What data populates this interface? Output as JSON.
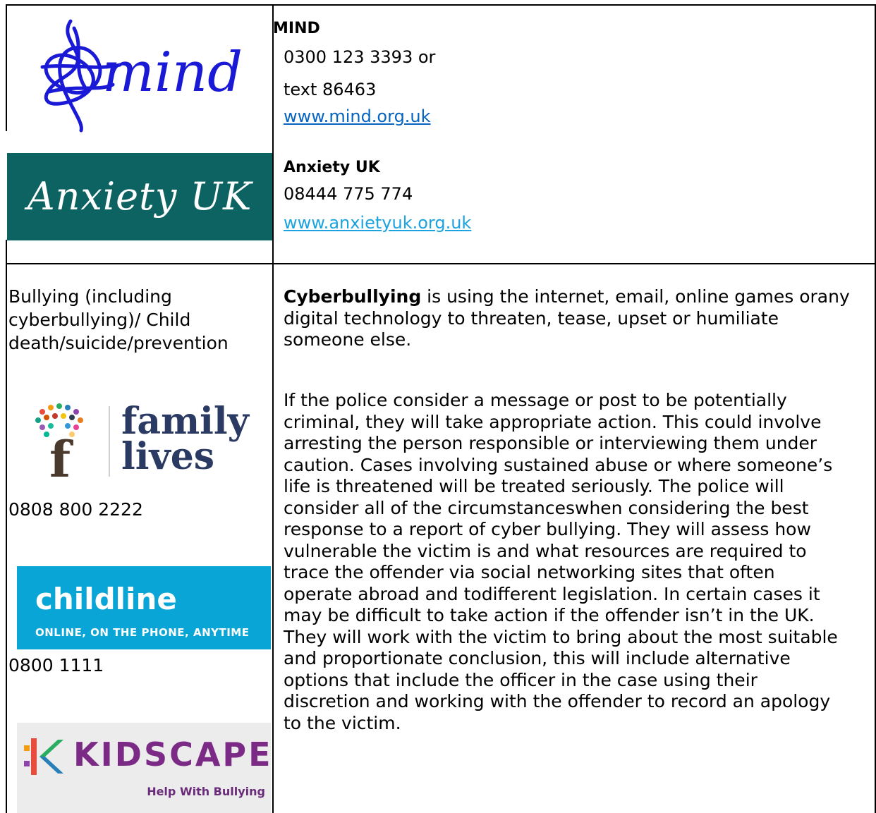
{
  "logos": {
    "mind": "mind",
    "anxiety_uk": "Anxiety UK",
    "family_lives": [
      "family",
      "lives"
    ],
    "childline": {
      "name": "childline",
      "tagline": "ONLINE, ON THE PHONE, ANYTIME"
    },
    "kidscape": {
      "name": "KIDSCAPE",
      "tagline": "Help With Bullying"
    }
  },
  "orgs": {
    "mind": {
      "name": "MIND",
      "phone": "0300 123 3393 or",
      "text": "text 86463",
      "url": "www.mind.org.uk"
    },
    "anxiety": {
      "name": "Anxiety UK",
      "phone": "08444 775 774",
      "url": "www.anxietyuk.org.uk"
    }
  },
  "bullying": {
    "topic": [
      "Bullying (including",
      "cyberbullying)/ Child",
      "death/suicide/prevention"
    ],
    "family_lives_phone": "0808 800 2222",
    "childline_phone": "0800 1111",
    "definition_term": "Cyberbullying",
    "definition_rest": [
      " is using the internet, email, online games orany",
      "digital technology to threaten, tease, upset or humiliate",
      "someone else."
    ],
    "police_paragraph": [
      "If the police consider a message or post to be potentially",
      "criminal, they will take appropriate action. This could involve",
      "arresting the person responsible or interviewing them under",
      "caution. Cases involving sustained abuse or where someone’s",
      "life is threatened will be treated seriously. The police will",
      "consider all of the circumstanceswhen considering the best",
      "response to a report of cyber bullying. They will assess how",
      "vulnerable the victim is and what resources are required to",
      "trace the offender via social networking sites that often",
      "operate abroad and todifferent legislation. In certain cases it",
      "may be difficult to take action if the offender isn’t in the UK.",
      "They will work with the victim to bring about the most suitable",
      "and proportionate conclusion, this will include alternative",
      "options that include the officer in the case using their",
      "discretion and working with the offender to record an apology",
      "to the victim."
    ]
  },
  "colors": {
    "link": "#0563c1",
    "anxiety_bg": "#0d6262",
    "childline_bg": "#08a5d6",
    "mind_blue": "#1a1ad6",
    "kidscape_purple": "#7b2a86"
  }
}
